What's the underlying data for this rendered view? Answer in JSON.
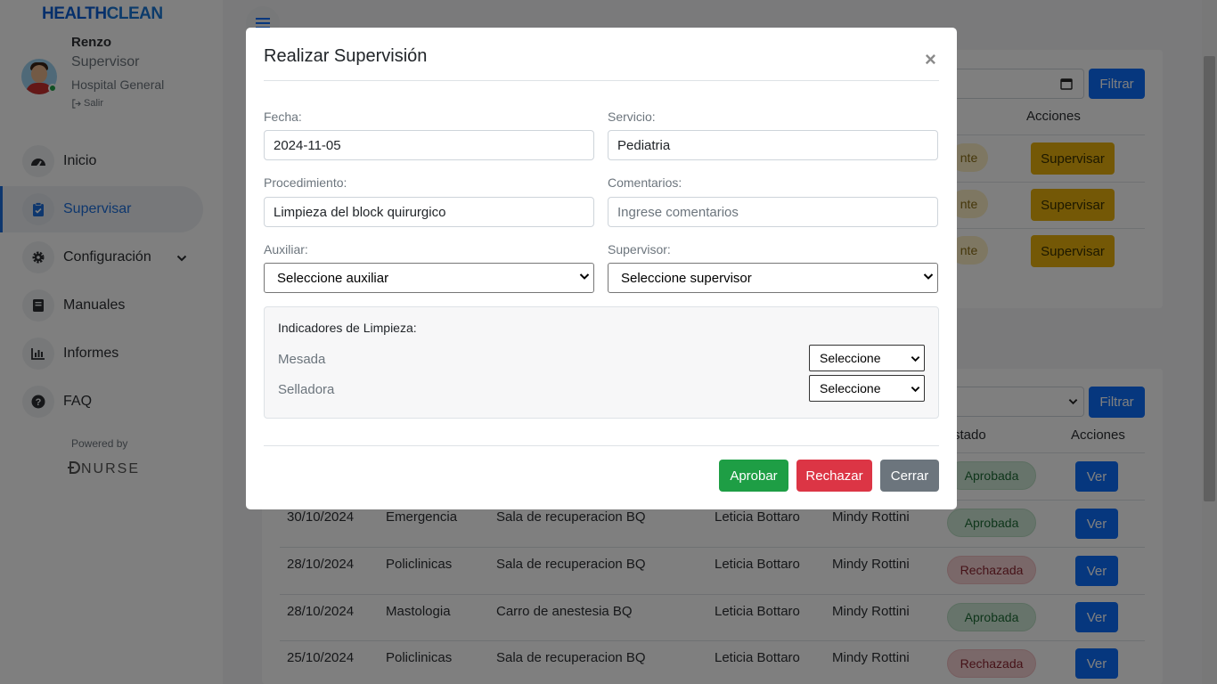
{
  "app": {
    "brand_part1": "HEALTH",
    "brand_part2": "CLEAN"
  },
  "user": {
    "name": "Renzo",
    "role": "Supervisor",
    "hospital": "Hospital General",
    "logout": "Salir"
  },
  "sidebar": {
    "items": [
      {
        "label": "Inicio",
        "icon": "dashboard-icon"
      },
      {
        "label": "Supervisar",
        "icon": "clipboard-check-icon"
      },
      {
        "label": "Configuración",
        "icon": "gear-icon"
      },
      {
        "label": "Manuales",
        "icon": "book-icon"
      },
      {
        "label": "Informes",
        "icon": "chart-icon"
      },
      {
        "label": "FAQ",
        "icon": "question-icon"
      }
    ],
    "powered_by": "Powered by",
    "powered_brand": "NURSE"
  },
  "background": {
    "filter_label": "Filtrar",
    "acciones_header": "Acciones",
    "estado_header": "stado",
    "pending_fragment": "nte",
    "supervisar_label": "Supervisar",
    "ver_label": "Ver",
    "rows": [
      {
        "date": "30/10/2024",
        "service": "Emergencia",
        "procedure": "Sala de recuperacion BQ",
        "aux": "Leticia Bottaro",
        "sup": "Mindy Rottini",
        "status": "Aprobada"
      },
      {
        "date": "28/10/2024",
        "service": "Policlinicas",
        "procedure": "Sala de recuperacion BQ",
        "aux": "Leticia Bottaro",
        "sup": "Mindy Rottini",
        "status": "Rechazada"
      },
      {
        "date": "28/10/2024",
        "service": "Mastologia",
        "procedure": "Carro de anestesia BQ",
        "aux": "Leticia Bottaro",
        "sup": "Mindy Rottini",
        "status": "Aprobada"
      },
      {
        "date": "25/10/2024",
        "service": "Policlinicas",
        "procedure": "Sala de recuperacion BQ",
        "aux": "Leticia Bottaro",
        "sup": "Mindy Rottini",
        "status": "Rechazada"
      }
    ],
    "top_status": "Aprobada"
  },
  "modal": {
    "title": "Realizar Supervisión",
    "close": "×",
    "fecha_label": "Fecha:",
    "fecha_value": "2024-11-05",
    "servicio_label": "Servicio:",
    "servicio_value": "Pediatria",
    "procedimiento_label": "Procedimiento:",
    "procedimiento_value": "Limpieza del block quirurgico",
    "comentarios_label": "Comentarios:",
    "comentarios_placeholder": "Ingrese comentarios",
    "auxiliar_label": "Auxiliar:",
    "auxiliar_value": "Seleccione auxiliar",
    "supervisor_label": "Supervisor:",
    "supervisor_value": "Seleccione supervisor",
    "indicadores_title": "Indicadores de Limpieza:",
    "indicators": [
      {
        "label": "Mesada",
        "value": "Seleccione"
      },
      {
        "label": "Selladora",
        "value": "Seleccione"
      }
    ],
    "buttons": {
      "approve": "Aprobar",
      "reject": "Rechazar",
      "close": "Cerrar"
    }
  },
  "colors": {
    "primary": "#0d6efd",
    "success": "#198754",
    "danger": "#dc3545",
    "secondary": "#6c757d",
    "warning": "#e8b10c"
  }
}
